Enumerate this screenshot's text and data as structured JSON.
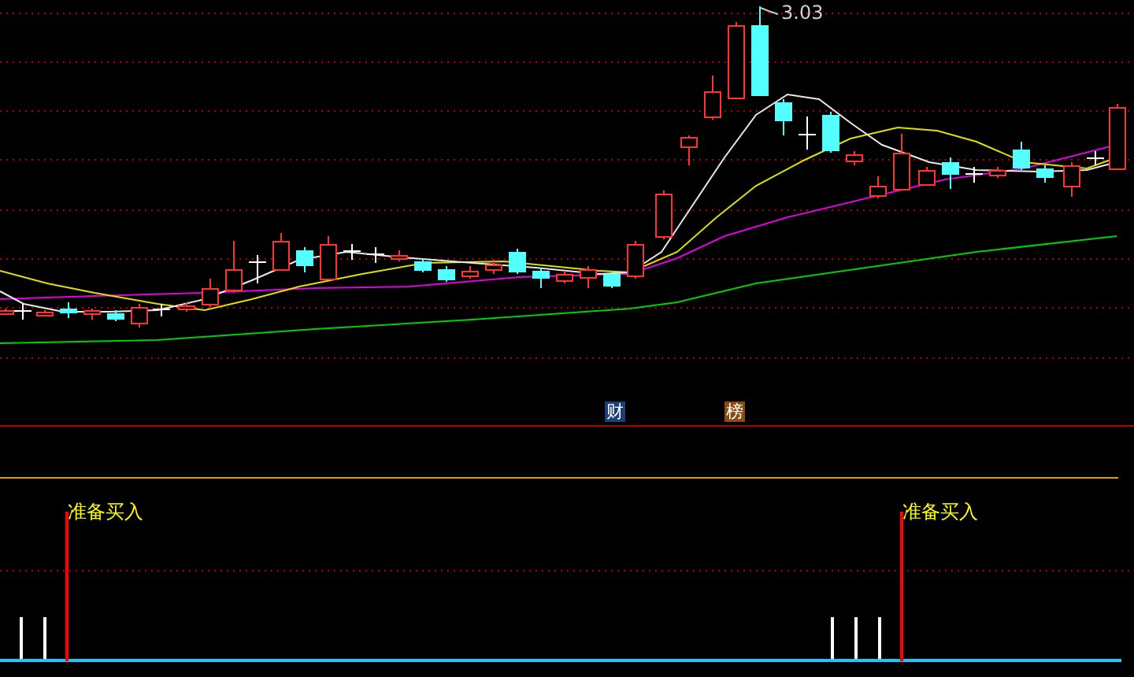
{
  "price_chart": {
    "high_label": "3.03"
  },
  "event_markers": [
    {
      "label": "财",
      "color": "#1c3f7a"
    },
    {
      "label": "榜",
      "color": "#8a4a12"
    }
  ],
  "signal_panel": {
    "signals": [
      {
        "label": "准备买入"
      },
      {
        "label": "准备买入"
      }
    ]
  }
}
